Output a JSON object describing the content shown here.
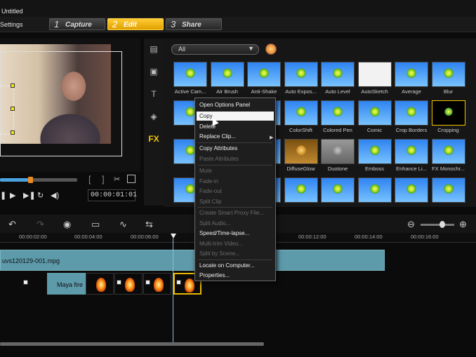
{
  "window": {
    "title": "Untitled"
  },
  "menu": {
    "settings": "Settings"
  },
  "steps": [
    {
      "num": "1",
      "label": "Capture"
    },
    {
      "num": "2",
      "label": "Edit"
    },
    {
      "num": "3",
      "label": "Share"
    }
  ],
  "player": {
    "timecode": "00:00:01:01",
    "progress_fraction": 0.37
  },
  "library": {
    "filter": "All",
    "rows": [
      [
        "Active Cam...",
        "Air Brush",
        "Anti-Shake",
        "Auto Expos...",
        "Auto Level",
        "AutoSketch",
        "Average",
        "Blur"
      ],
      [
        "",
        "",
        "",
        "ColorShift",
        "Colored Pen",
        "Comic",
        "Crop Borders",
        "Cropping"
      ],
      [
        "",
        "",
        "",
        "DiffuseGlow",
        "Duotone",
        "Emboss",
        "Enhance Li...",
        "FX Monochr..."
      ],
      [
        "",
        "",
        "",
        "",
        "",
        "",
        "",
        ""
      ]
    ]
  },
  "context_menu": {
    "items": [
      {
        "label": "Open Options Panel",
        "enabled": true
      },
      {
        "label": "Copy",
        "enabled": true,
        "highlighted": true
      },
      {
        "label": "Delete",
        "enabled": true
      },
      {
        "label": "Replace Clip...",
        "enabled": true,
        "submenu": true
      },
      {
        "label": "Copy Attributes",
        "enabled": true
      },
      {
        "label": "Paste Attributes",
        "enabled": false
      },
      {
        "label": "Mute",
        "enabled": false
      },
      {
        "label": "Fade-in",
        "enabled": false
      },
      {
        "label": "Fade-out",
        "enabled": false
      },
      {
        "label": "Split Clip",
        "enabled": false
      },
      {
        "label": "Create Smart Proxy File...",
        "enabled": false
      },
      {
        "label": "Split Audio...",
        "enabled": false
      },
      {
        "label": "Speed/Time-lapse...",
        "enabled": true
      },
      {
        "label": "Multi-trim Video...",
        "enabled": false
      },
      {
        "label": "Split by Scene...",
        "enabled": false
      },
      {
        "label": "Locate on Computer...",
        "enabled": true
      },
      {
        "label": "Properties...",
        "enabled": true
      }
    ]
  },
  "ruler": {
    "ticks": [
      "00:00:02:00",
      "00:00:04:00",
      "00:00:06:00",
      "00:00:12:00",
      "00:00:14:00",
      "00:00:16:00"
    ]
  },
  "timeline": {
    "video_clip": "uvs120129-001.mpg",
    "title_clip": "Maya fire"
  },
  "colors": {
    "accent": "#f2c600",
    "clip": "#5d9aaa"
  }
}
